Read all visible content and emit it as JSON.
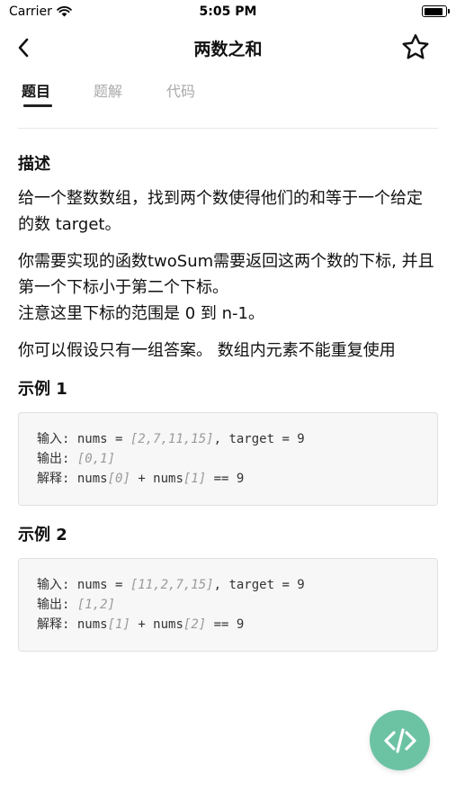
{
  "status_bar": {
    "carrier": "Carrier",
    "time": "5:05 PM",
    "battery_level": 0.9
  },
  "nav": {
    "title": "两数之和",
    "back_icon": "chevron-left-icon",
    "favorite_icon": "star-icon"
  },
  "tabs": [
    {
      "label": "题目",
      "active": true
    },
    {
      "label": "题解",
      "active": false
    },
    {
      "label": "代码",
      "active": false
    }
  ],
  "content": {
    "description_heading": "描述",
    "paragraphs": [
      "给一个整数数组，找到两个数使得他们的和等于一个给定的数 target。",
      "你需要实现的函数twoSum需要返回这两个数的下标, 并且第一个下标小于第二个下标。\n注意这里下标的范围是 0 到 n-1。",
      "你可以假设只有一组答案。 数组内元素不能重复使用"
    ],
    "examples": [
      {
        "heading": "示例 1",
        "input_label": "输入:",
        "input_var": " nums = ",
        "input_array": "[2,7,11,15]",
        "input_rest": ", target = 9",
        "output_label": "输出:",
        "output_value": " [0,1]",
        "explain_label": "解释:",
        "explain_a": " nums",
        "explain_a_idx": "[0]",
        "explain_op": " + nums",
        "explain_b_idx": "[1]",
        "explain_rest": " == 9"
      },
      {
        "heading": "示例 2",
        "input_label": "输入:",
        "input_var": " nums = ",
        "input_array": "[11,2,7,15]",
        "input_rest": ", target = 9",
        "output_label": "输出:",
        "output_value": " [1,2]",
        "explain_label": "解释:",
        "explain_a": " nums",
        "explain_a_idx": "[1]",
        "explain_op": " + nums",
        "explain_b_idx": "[2]",
        "explain_rest": " == 9"
      }
    ]
  },
  "fab": {
    "icon": "code-icon"
  },
  "colors": {
    "accent": "#6cc3a4",
    "text": "#111111",
    "muted": "#a9a9a9",
    "code_bg": "#f7f7f7"
  }
}
